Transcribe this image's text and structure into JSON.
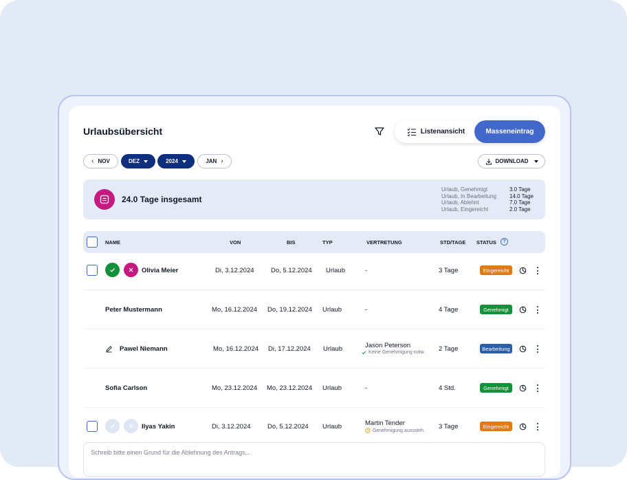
{
  "page": {
    "title": "Urlaubsübersicht",
    "filter_icon": "filter-icon"
  },
  "view_toggle": {
    "list_label": "Listenansicht",
    "mass_label": "Masseneintrag",
    "list_icon": "checklist-icon"
  },
  "period": {
    "prev_month": "NOV",
    "month": "DEZ",
    "year": "2024",
    "next_month": "JAN"
  },
  "download_label": "DOWNLOAD",
  "summary": {
    "total": "24.0 Tage insgesamt",
    "icon": "calendar-icon",
    "breakdown": [
      {
        "label": "Urlaub, Genehmigt",
        "value": "3.0 Tage"
      },
      {
        "label": "Urlaub, In Bearbeitung",
        "value": "14.0 Tage"
      },
      {
        "label": "Urlaub, Ablehnt",
        "value": "7.0 Tage"
      },
      {
        "label": "Urlaub, Eingereicht",
        "value": "2.0 Tage"
      }
    ]
  },
  "table": {
    "headers": {
      "name": "NAME",
      "from": "VON",
      "to": "BIS",
      "type": "TYP",
      "substitute": "VERTRETUNG",
      "hours_days": "STD/TAGE",
      "status": "STATUS",
      "help": "?"
    },
    "rows": [
      {
        "name": "Olivia Meier",
        "from": "Di, 3.12.2024",
        "to": "Do, 5.12.2024",
        "type": "Urlaub",
        "substitute": "-",
        "substitute_note": "",
        "amount": "3 Tage",
        "status": "Eingereicht",
        "status_color": "#e07a12"
      },
      {
        "name": "Peter Mustermann",
        "from": "Mo, 16.12.2024",
        "to": "Do, 19.12.2024",
        "type": "Urlaub",
        "substitute": "-",
        "substitute_note": "",
        "amount": "4 Tage",
        "status": "Genehmigt",
        "status_color": "#13913a"
      },
      {
        "name": "Pawel Niemann",
        "from": "Mo, 16.12.2024",
        "to": "Di, 17.12.2024",
        "type": "Urlaub",
        "substitute": "Jason Peterson",
        "substitute_note": "Keine Genehmigung notw.",
        "amount": "2 Tage",
        "status": "Bearbeitung",
        "status_color": "#2c5ea8"
      },
      {
        "name": "Sofia Carlson",
        "from": "Mo, 23.12.2024",
        "to": "Mo, 23.12.2024",
        "type": "Urlaub",
        "substitute": "-",
        "substitute_note": "",
        "amount": "4 Std.",
        "status": "Genehmigt",
        "status_color": "#13913a"
      },
      {
        "name": "Ilyas Yakin",
        "from": "Di, 3.12.2024",
        "to": "Do, 5.12.2024",
        "type": "Urlaub",
        "substitute": "Martin Tender",
        "substitute_note": "Genehmigung ausssteh.",
        "amount": "3 Tage",
        "status": "Eingereicht",
        "status_color": "#e07a12"
      }
    ]
  },
  "rejection": {
    "placeholder": "Schreib bitte einen Grund für die Ablehnung des Antrags..."
  },
  "colors": {
    "primary": "#4268c9",
    "navy": "#0d2f7d",
    "approve": "#13913a",
    "reject": "#c51a7f",
    "panel": "#e4ebf6"
  }
}
